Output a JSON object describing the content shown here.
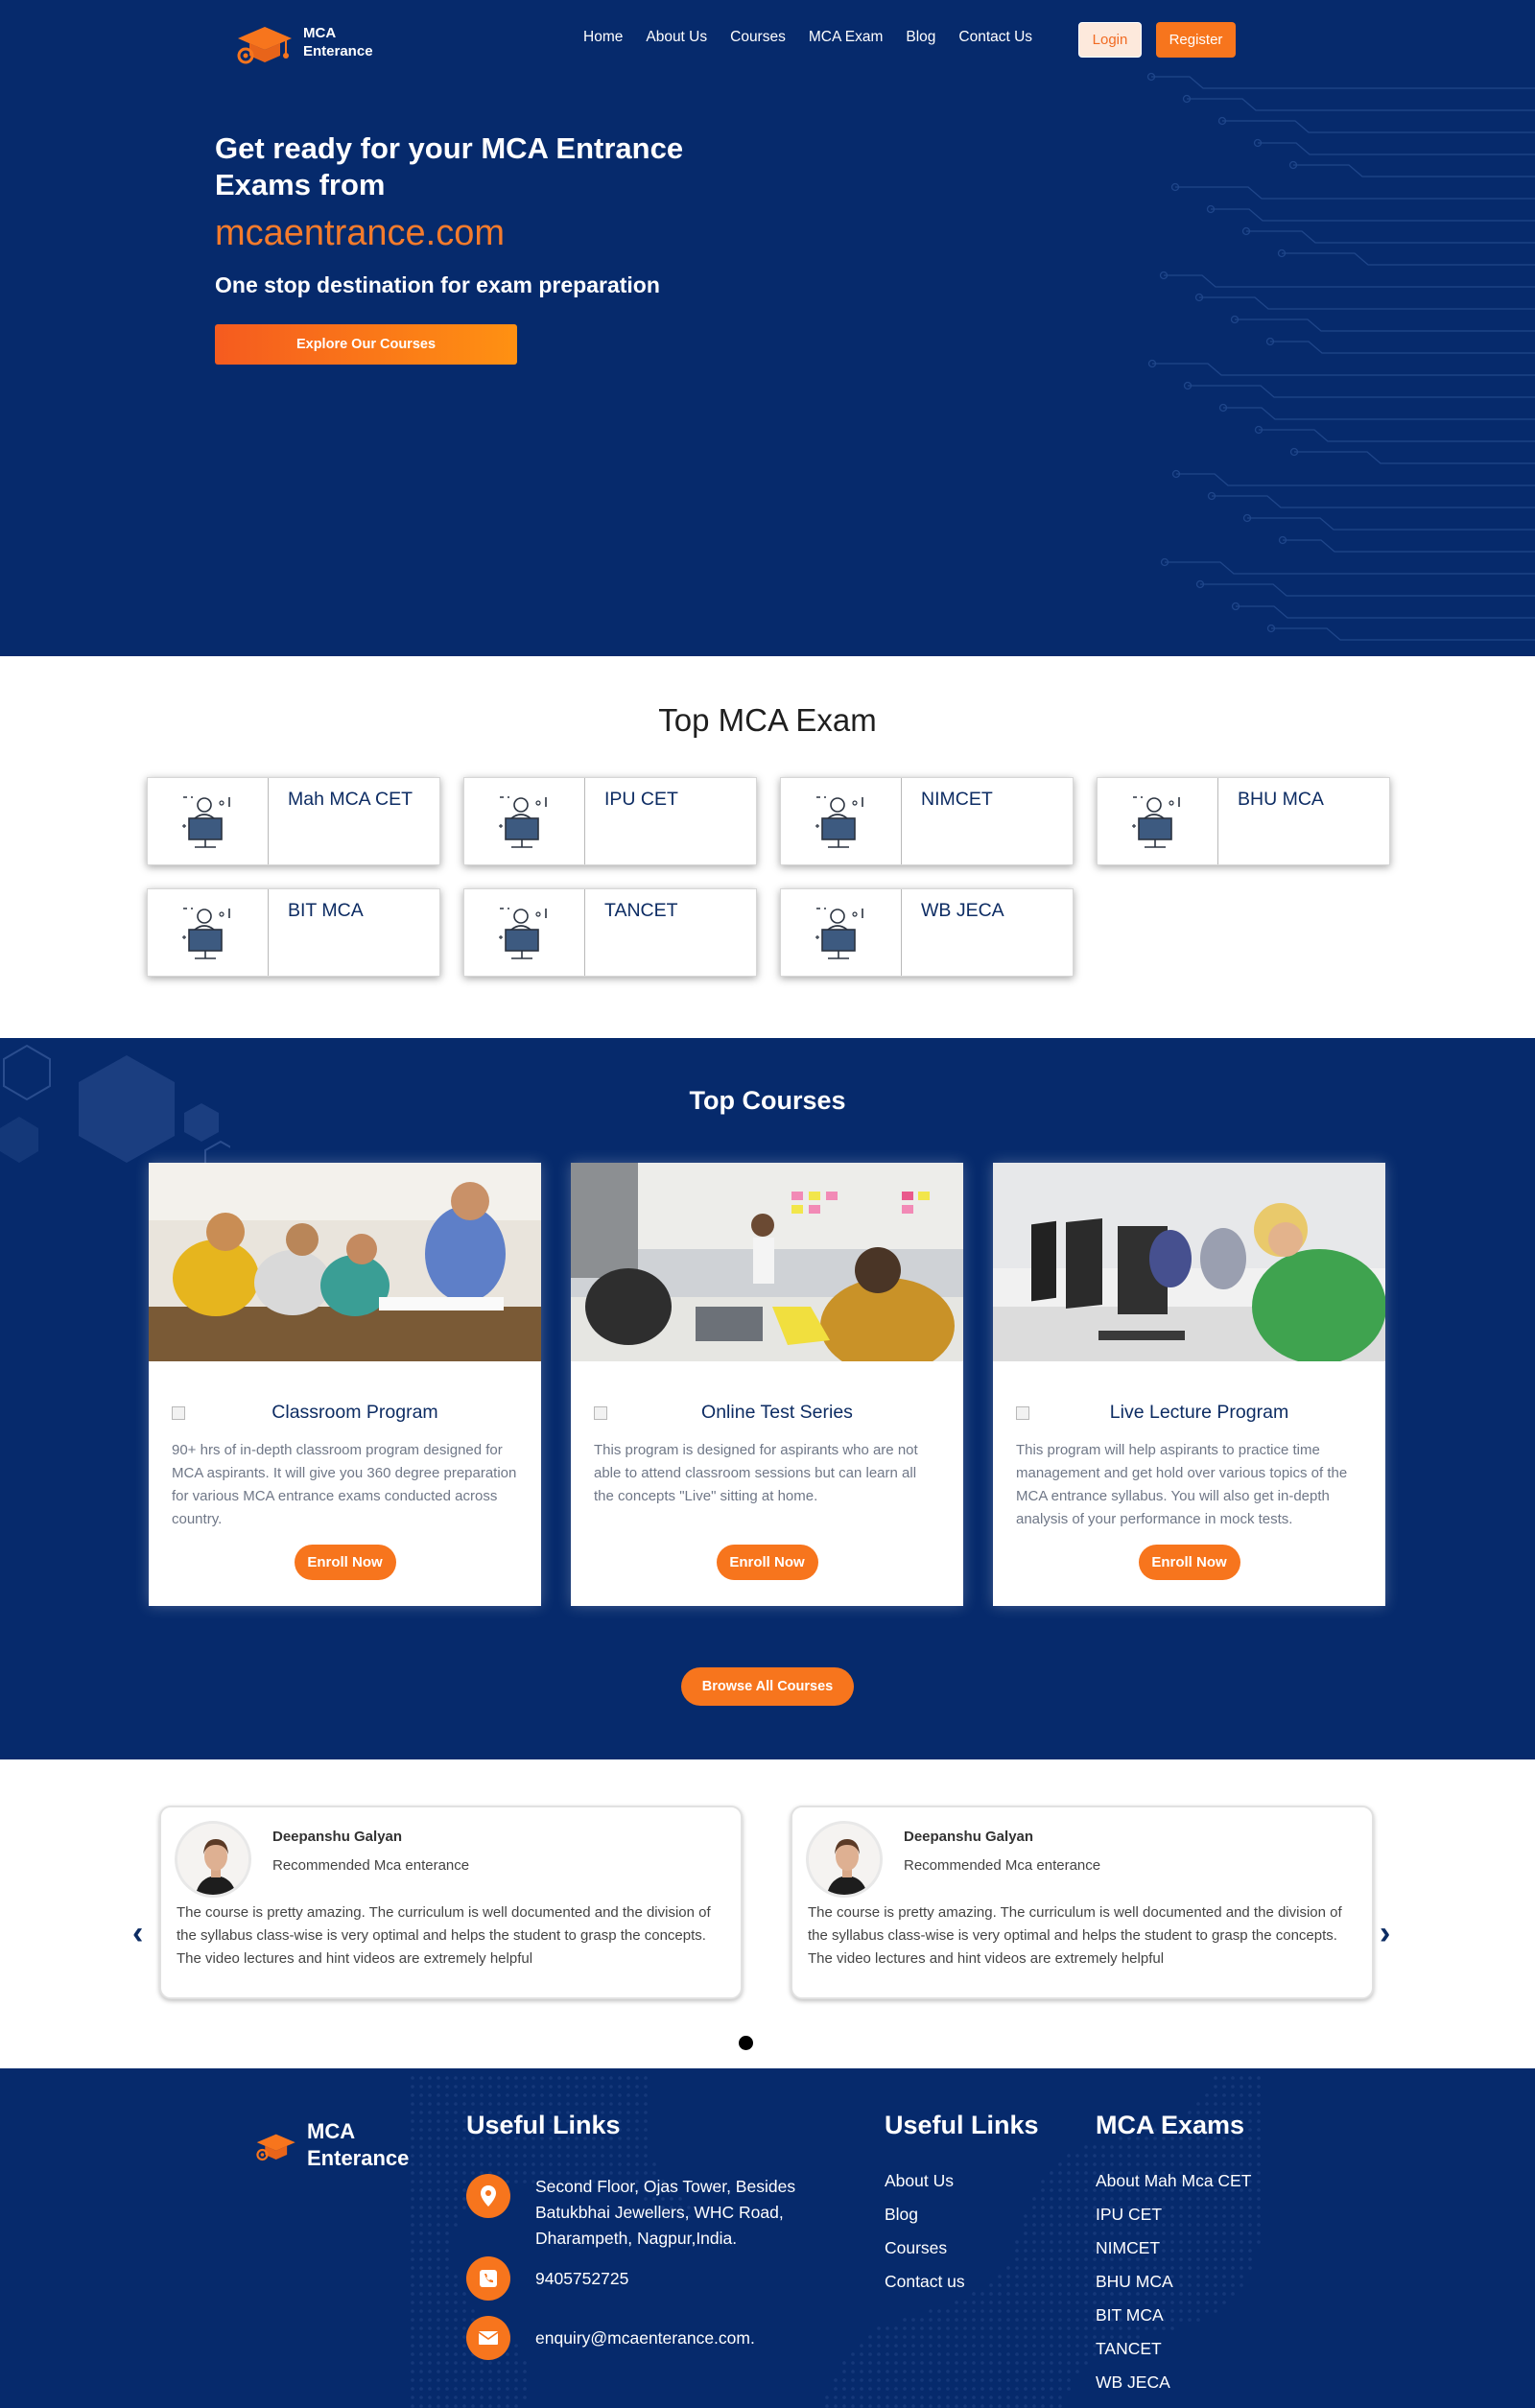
{
  "nav": {
    "brand_line1": "MCA",
    "brand_line2": "Enterance",
    "items": [
      "Home",
      "About Us",
      "Courses",
      "MCA Exam",
      "Blog",
      "Contact Us"
    ],
    "login": "Login",
    "register": "Register"
  },
  "hero": {
    "title": "Get ready for your MCA Entrance Exams from",
    "domain": "mcaentrance.com",
    "subtitle": "One stop destination for exam preparation",
    "cta": "Explore Our Courses"
  },
  "exams": {
    "title": "Top MCA Exam",
    "items": [
      "Mah MCA CET",
      "IPU CET",
      "NIMCET",
      "BHU MCA",
      "BIT MCA",
      "TANCET",
      "WB JECA"
    ]
  },
  "courses": {
    "title": "Top Courses",
    "items": [
      {
        "title": "Classroom Program",
        "desc": "90+ hrs of in-depth classroom program designed for MCA aspirants. It will give you 360 degree preparation for various MCA entrance exams conducted across country.",
        "cta": "Enroll Now"
      },
      {
        "title": "Online Test Series",
        "desc": "This program is designed for aspirants who are not able to attend classroom sessions but can learn all the concepts \"Live\" sitting at home.",
        "cta": "Enroll Now"
      },
      {
        "title": "Live Lecture Program",
        "desc": "This program will help aspirants to practice time management and get hold over various topics of the MCA entrance syllabus. You will also get in-depth analysis of your performance in mock tests.",
        "cta": "Enroll Now"
      }
    ],
    "browse": "Browse All Courses"
  },
  "testimonials": {
    "items": [
      {
        "name": "Deepanshu Galyan",
        "role": "Recommended Mca enterance",
        "text": "The course is pretty amazing. The curriculum is well documented and the division of the syllabus class-wise is very optimal and helps the student to grasp the concepts. The video lectures and hint videos are extremely helpful"
      },
      {
        "name": "Deepanshu Galyan",
        "role": "Recommended Mca enterance",
        "text": "The course is pretty amazing. The curriculum is well documented and the division of the syllabus class-wise is very optimal and helps the student to grasp the concepts. The video lectures and hint videos are extremely helpful"
      }
    ],
    "prev": "‹",
    "next": "›"
  },
  "footer": {
    "brand_line1": "MCA",
    "brand_line2": "Enterance",
    "col1_title": "Useful Links",
    "address": "Second Floor, Ojas Tower, Besides Batukbhai Jewellers, WHC Road, Dharampeth, Nagpur,India.",
    "phone": "9405752725",
    "email": "enquiry@mcaenterance.com.",
    "col2_title": "Useful Links",
    "links": [
      "About Us",
      "Blog",
      "Courses",
      "Contact us"
    ],
    "col3_title": "MCA Exams",
    "exams": [
      "About Mah Mca CET",
      "IPU CET",
      "NIMCET",
      "BHU MCA",
      "BIT MCA",
      "TANCET",
      "WB JECA"
    ]
  },
  "colors": {
    "navy": "#062a6c",
    "orange": "#f7751d",
    "heading_navy": "#0d2c63"
  }
}
